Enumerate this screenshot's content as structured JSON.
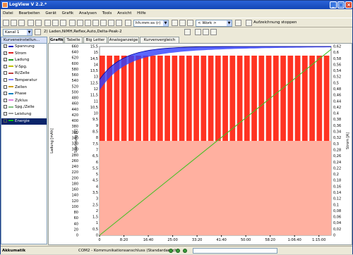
{
  "window": {
    "title": "LogView V 2.2.*"
  },
  "menu": [
    "Datei",
    "Bearbeiten",
    "Gerät",
    "Grafik",
    "Analysen",
    "Tools",
    "Ansicht",
    "Hilfe"
  ],
  "toolbar": {
    "time_format": "hh:mm:ss (r)",
    "work_select": "< Work >",
    "stop_label": "Aufzeichnung stoppen"
  },
  "toolbar2": {
    "channel": "Kanal 1",
    "file": "2) Laden,NiMH,Reflex,Auto,Delta-Peak-2"
  },
  "left_panel": {
    "header": "Kurveneinstellun...",
    "items": [
      {
        "label": "Spannung",
        "checked": true,
        "color": "#0000c0"
      },
      {
        "label": "Strom",
        "checked": true,
        "color": "#e02020"
      },
      {
        "label": "Ladung",
        "checked": true,
        "color": "#20a020"
      },
      {
        "label": "V-Spg.",
        "checked": false,
        "color": "#c0c000"
      },
      {
        "label": "Ri/Zelle",
        "checked": false,
        "color": "#c04040"
      },
      {
        "label": "Temperatur",
        "checked": false,
        "color": "#8080ff"
      },
      {
        "label": "Zellen",
        "checked": false,
        "color": "#d0a000"
      },
      {
        "label": "Phase",
        "checked": false,
        "color": "#0080c0"
      },
      {
        "label": "Zyklus",
        "checked": false,
        "color": "#e080e0"
      },
      {
        "label": "Spg./Zelle",
        "checked": false,
        "color": "#80c080"
      },
      {
        "label": "Leistung",
        "checked": false,
        "color": "#a0a0a0"
      },
      {
        "label": "Energie",
        "checked": false,
        "color": "#00c000",
        "selected": true
      }
    ]
  },
  "tabs": [
    "Grafik",
    "Tabelle",
    "Big Letter",
    "Analoganzeige",
    "Kurvenvergleich"
  ],
  "chart_data": {
    "type": "area",
    "x_ticks": [
      "0",
      "8:20",
      "16:40",
      "25:00",
      "33:20",
      "41:40",
      "50:00",
      "58:20",
      "1:06:40",
      "1:15:00"
    ],
    "y_left1": {
      "label": "Ladung [mAh]",
      "ticks": [
        0,
        20,
        40,
        60,
        80,
        100,
        120,
        140,
        160,
        180,
        200,
        220,
        240,
        260,
        280,
        300,
        320,
        340,
        360,
        380,
        400,
        420,
        440,
        460,
        480,
        500,
        520,
        540,
        560,
        580,
        600,
        620,
        640,
        660
      ]
    },
    "y_left2": {
      "label": "Spannung [V]",
      "ticks": [
        "0",
        "0,5",
        "1",
        "1,5",
        "2",
        "2,5",
        "3",
        "3,5",
        "4",
        "4,5",
        "5",
        "5,5",
        "6",
        "6,5",
        "7",
        "7,5",
        "8",
        "8,5",
        "9",
        "9,5",
        "10",
        "10,5",
        "11",
        "11,5",
        "12",
        "12,5",
        "13",
        "13,5",
        "14",
        "14,5",
        "15",
        "15,5"
      ]
    },
    "y_right": {
      "label": "Strom [A]",
      "ticks": [
        "0",
        "0,02",
        "0,04",
        "0,06",
        "0,08",
        "0,1",
        "0,12",
        "0,14",
        "0,16",
        "0,18",
        "0,2",
        "0,22",
        "0,24",
        "0,26",
        "0,28",
        "0,3",
        "0,32",
        "0,34",
        "0,36",
        "0,38",
        "0,4",
        "0,42",
        "0,44",
        "0,46",
        "0,48",
        "0,5",
        "0,52",
        "0,54",
        "0,56",
        "0,58",
        "0,6",
        "0,62"
      ]
    },
    "x_max_min": 80,
    "series": [
      {
        "name": "Strom",
        "color": "#ff2a1a",
        "pulse_high": 0.59,
        "pulse_base": 0.31,
        "period_min": 2.5
      },
      {
        "name": "Spannung",
        "color": "#2040ff",
        "start": 12.8,
        "end": 15.5
      },
      {
        "name": "Ladung",
        "color": "#40c020",
        "start": 0,
        "end": 650
      }
    ]
  },
  "status": {
    "left": "Akkumatik",
    "port": "COM2 - Kommunikationsanschluss (Standardanschl"
  }
}
